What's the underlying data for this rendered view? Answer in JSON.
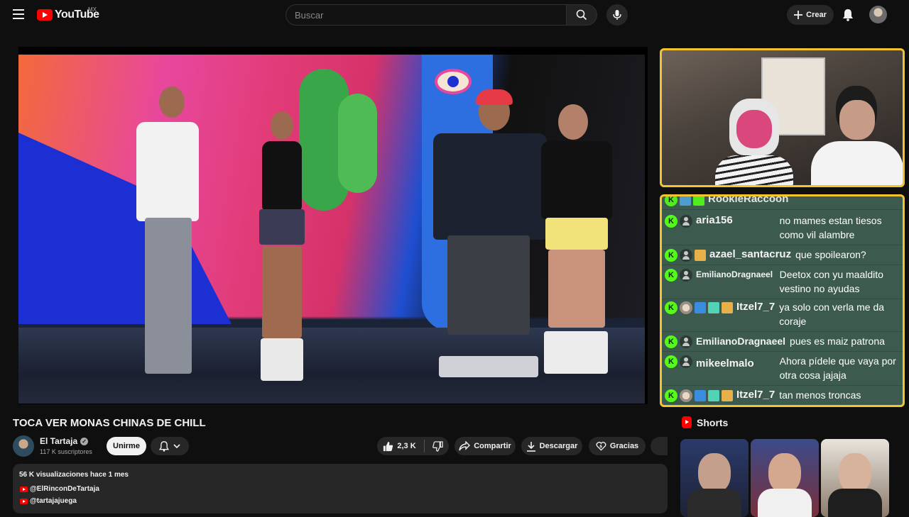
{
  "header": {
    "logo_text": "YouTube",
    "country_code": "MX",
    "search_placeholder": "Buscar",
    "create_label": "Crear",
    "icons": [
      "menu-icon",
      "search-icon",
      "microphone-icon",
      "plus-icon",
      "bell-icon"
    ]
  },
  "chat": {
    "partial_top_name": "RookieRaccoon",
    "messages": [
      {
        "user": "aria156",
        "text": "no mames estan tiesos como vil alambre"
      },
      {
        "user": "azael_santacruz",
        "text": "que spoilearon?"
      },
      {
        "user": "EmilianoDragnaeel",
        "text": "Deetox con yu maaldito vestino no ayudas"
      },
      {
        "user": "Itzel7_7",
        "text": "ya solo con verla me da coraje"
      },
      {
        "user": "EmilianoDragnaeel",
        "text": "pues es maiz patrona"
      },
      {
        "user": "mikeelmalo",
        "text": "Ahora pídele que vaya por otra cosa jajaja"
      },
      {
        "user": "Itzel7_7",
        "text": "tan menos troncas"
      }
    ],
    "colors": {
      "border": "#f4c430",
      "background": "#3d5a4f",
      "kick_badge": "#53fc18"
    }
  },
  "video": {
    "title": "TOCA VER MONAS CHINAS DE CHILL",
    "channel_name": "El Tartaja",
    "subscribers": "117 K suscriptores",
    "join_label": "Unirme",
    "likes": "2,3 K",
    "share_label": "Compartir",
    "download_label": "Descargar",
    "thanks_label": "Gracias"
  },
  "description": {
    "stats": "56 K visualizaciones  hace 1 mes",
    "links": [
      "@ElRinconDeTartaja",
      "@tartajajuega"
    ]
  },
  "shorts": {
    "heading": "Shorts"
  }
}
